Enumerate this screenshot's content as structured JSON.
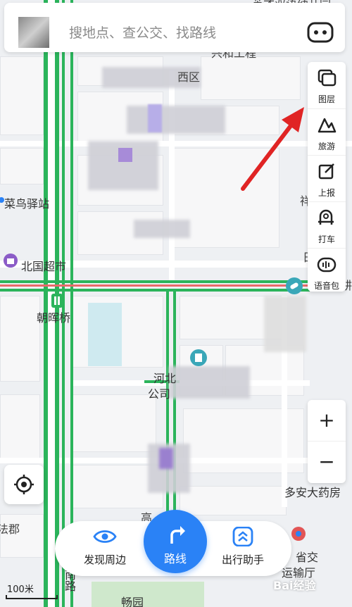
{
  "search": {
    "placeholder": "搜地点、查公交、找路线"
  },
  "tools": [
    {
      "label": "图层",
      "icon": "layers-icon"
    },
    {
      "label": "旅游",
      "icon": "travel-icon"
    },
    {
      "label": "上报",
      "icon": "report-edit-icon"
    },
    {
      "label": "打车",
      "icon": "taxi-icon"
    },
    {
      "label": "语音包",
      "icon": "voice-pack-icon"
    }
  ],
  "zoom": {
    "in": "+",
    "out": "−"
  },
  "bottom_bar": {
    "discover": "发现周边",
    "route": "路线",
    "assistant": "出行助手"
  },
  "map_labels": {
    "top_partial": "英才双语幼儿园",
    "top2_partial": "兴和工程",
    "district": "西区",
    "cainiao": "菜鸟驿站",
    "beiguo": "北国超市",
    "chaohui": "朝晖桥",
    "hebei": "河北",
    "gongsi": "公司",
    "duoan": "多安大药房",
    "right_partial1": "祥",
    "right_partial2": "日",
    "right_partial3": "耕",
    "gao": "高",
    "left_partial": "法郡",
    "south_road": "南路",
    "changyuan": "畅园",
    "shengjiao": "省交",
    "yunshu": "运输厅"
  },
  "scale": {
    "label": "100米"
  },
  "watermark": "Bai经验",
  "colors": {
    "accent_blue": "#2a82f6",
    "road_green": "#2bb45b",
    "arrow_red": "#e02424",
    "poi_purple": "#8b5cc7",
    "poi_teal": "#3aa7b8"
  }
}
